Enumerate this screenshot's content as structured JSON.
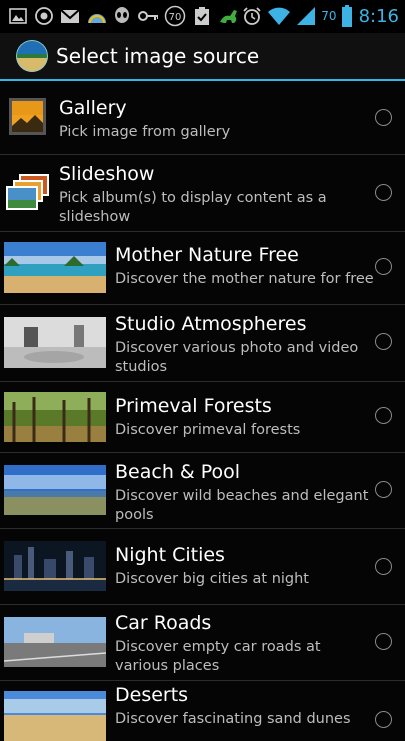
{
  "status_bar": {
    "badge_number": "70",
    "battery_percent": "70",
    "time": "8:16"
  },
  "dialog": {
    "title": "Select image source"
  },
  "items": [
    {
      "title": "Gallery",
      "subtitle": "Pick image from gallery"
    },
    {
      "title": "Slideshow",
      "subtitle": "Pick album(s) to display content as a slideshow"
    },
    {
      "title": "Mother Nature Free",
      "subtitle": "Discover the mother nature for free"
    },
    {
      "title": "Studio Atmospheres",
      "subtitle": "Discover various photo and video studios"
    },
    {
      "title": "Primeval Forests",
      "subtitle": "Discover primeval forests"
    },
    {
      "title": "Beach & Pool",
      "subtitle": "Discover wild beaches and elegant pools"
    },
    {
      "title": "Night Cities",
      "subtitle": "Discover big cities at night"
    },
    {
      "title": "Car Roads",
      "subtitle": "Discover empty car roads at various places"
    },
    {
      "title": "Deserts",
      "subtitle": "Discover fascinating sand dunes"
    }
  ],
  "colors": {
    "accent": "#33b5e5",
    "background": "#000000",
    "subtitle_text": "#bdbdbd"
  }
}
